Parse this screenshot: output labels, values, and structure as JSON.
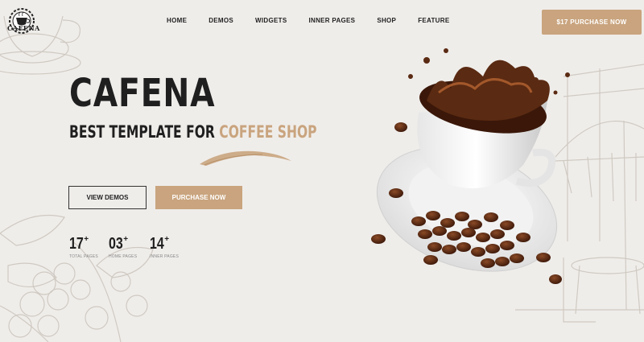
{
  "brand": {
    "logo_text": "CAFENA",
    "logo_icon": "coffee-cup-gear-icon"
  },
  "nav": {
    "items": [
      {
        "label": "HOME"
      },
      {
        "label": "DEMOS"
      },
      {
        "label": "WIDGETS"
      },
      {
        "label": "INNER PAGES"
      },
      {
        "label": "SHOP"
      },
      {
        "label": "FEATURE"
      }
    ]
  },
  "header": {
    "cta_label": "$17 PURCHASE NOW"
  },
  "hero": {
    "title": "CAFENA",
    "subtitle_lead": "BEST TEMPLATE FOR ",
    "subtitle_accent": "COFFEE SHOP",
    "view_demos_label": "VIEW DEMOS",
    "purchase_label": "PURCHASE NOW",
    "image": "coffee-cup-splash-with-beans"
  },
  "stats": [
    {
      "value": "17",
      "suffix": "+",
      "label": "TOTAL PAGES"
    },
    {
      "value": "03",
      "suffix": "+",
      "label": "HOME PAGES"
    },
    {
      "value": "14",
      "suffix": "+",
      "label": "INNER PAGES"
    }
  ],
  "colors": {
    "background": "#efedea",
    "accent": "#c9a47e",
    "text": "#1f1f1f",
    "coffee": "#4a2313"
  }
}
